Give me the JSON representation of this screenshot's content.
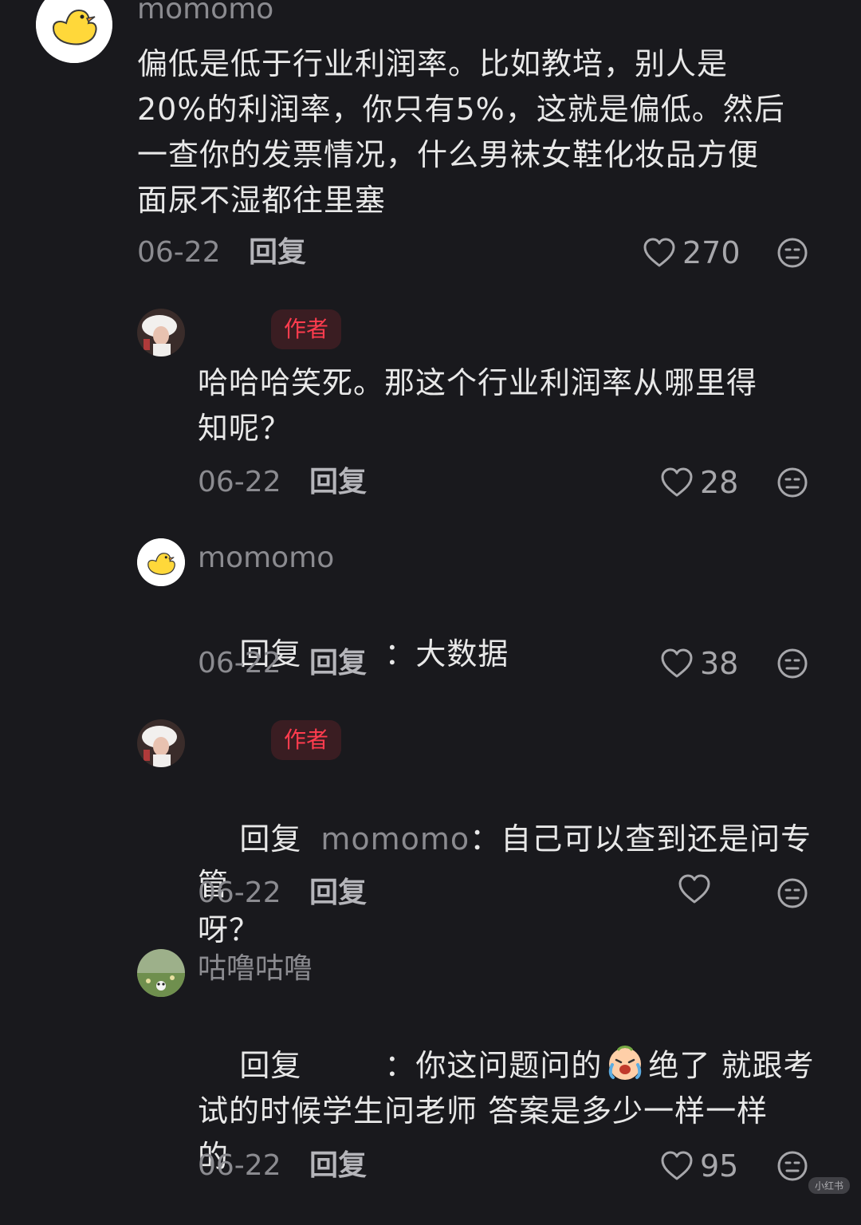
{
  "comments": [
    {
      "name": "momomo",
      "text": "偏低是低于行业利润率。比如教培，别人是\n20%的利润率，你只有5%，这就是偏低。然后\n一查你的发票情况，什么男袜女鞋化妆品方便\n面尿不湿都往里塞",
      "date": "06-22",
      "reply_label": "回复",
      "likes": "270"
    },
    {
      "badge": "作者",
      "text": "哈哈哈笑死。那这个行业利润率从哪里得\n知呢？",
      "date": "06-22",
      "reply_label": "回复",
      "likes": "28"
    },
    {
      "name": "momomo",
      "reply_prefix": "回复",
      "separator": "：",
      "text_after": "大数据",
      "date": "06-22",
      "reply_label": "回复",
      "likes": "38"
    },
    {
      "badge": "作者",
      "reply_prefix": "回复",
      "mention": "momomo",
      "separator": "：",
      "text_line1": "自己可以查到还是问专管",
      "text_line2": "呀？",
      "date": "06-22",
      "reply_label": "回复",
      "likes": ""
    },
    {
      "name": "咕噜咕噜",
      "reply_prefix": "回复",
      "separator": "：",
      "text_a": "你这问题问的",
      "emoji": "crying-laughing-emoji",
      "text_b": "绝了 就跟考",
      "text_line2": "试的时候学生问老师 答案是多少一样一样",
      "text_line3": "的",
      "date": "06-22",
      "reply_label": "回复",
      "likes": "95"
    }
  ],
  "watermark": "小红书",
  "icons": {
    "like": "heart-outline-icon",
    "react": "expressionless-face-icon"
  },
  "colors": {
    "background": "#19191d",
    "author_badge_bg": "#3a1d22",
    "author_badge_text": "#ff3c4e",
    "secondary_text": "#8b8b90"
  }
}
